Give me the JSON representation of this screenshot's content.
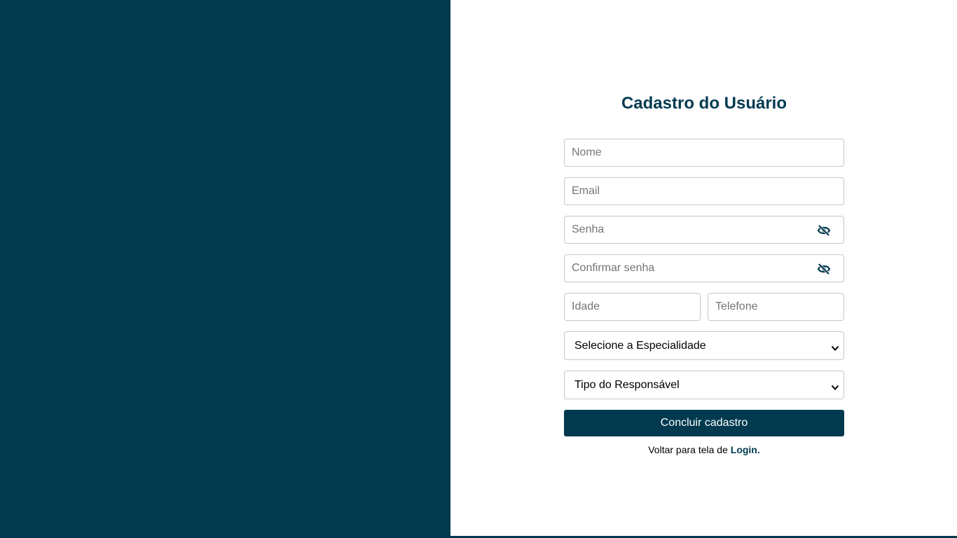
{
  "colors": {
    "brand": "#013a4f",
    "background": "#ffffff",
    "field_border": "#c7c7c7",
    "placeholder": "#757575"
  },
  "form": {
    "title": "Cadastro do Usuário",
    "name_placeholder": "Nome",
    "email_placeholder": "Email",
    "password_placeholder": "Senha",
    "confirm_password_placeholder": "Confirmar senha",
    "age_placeholder": "Idade",
    "phone_placeholder": "Telefone",
    "specialty_select": "Selecione a Especialidade",
    "responsible_select": "Tipo do Responsável",
    "submit_label": "Concluir cadastro",
    "back_text": "Voltar para tela de",
    "back_link": "Login."
  },
  "icons": {
    "password_toggle": "eye-slash-icon",
    "select_chevron": "chevron-down-icon"
  }
}
